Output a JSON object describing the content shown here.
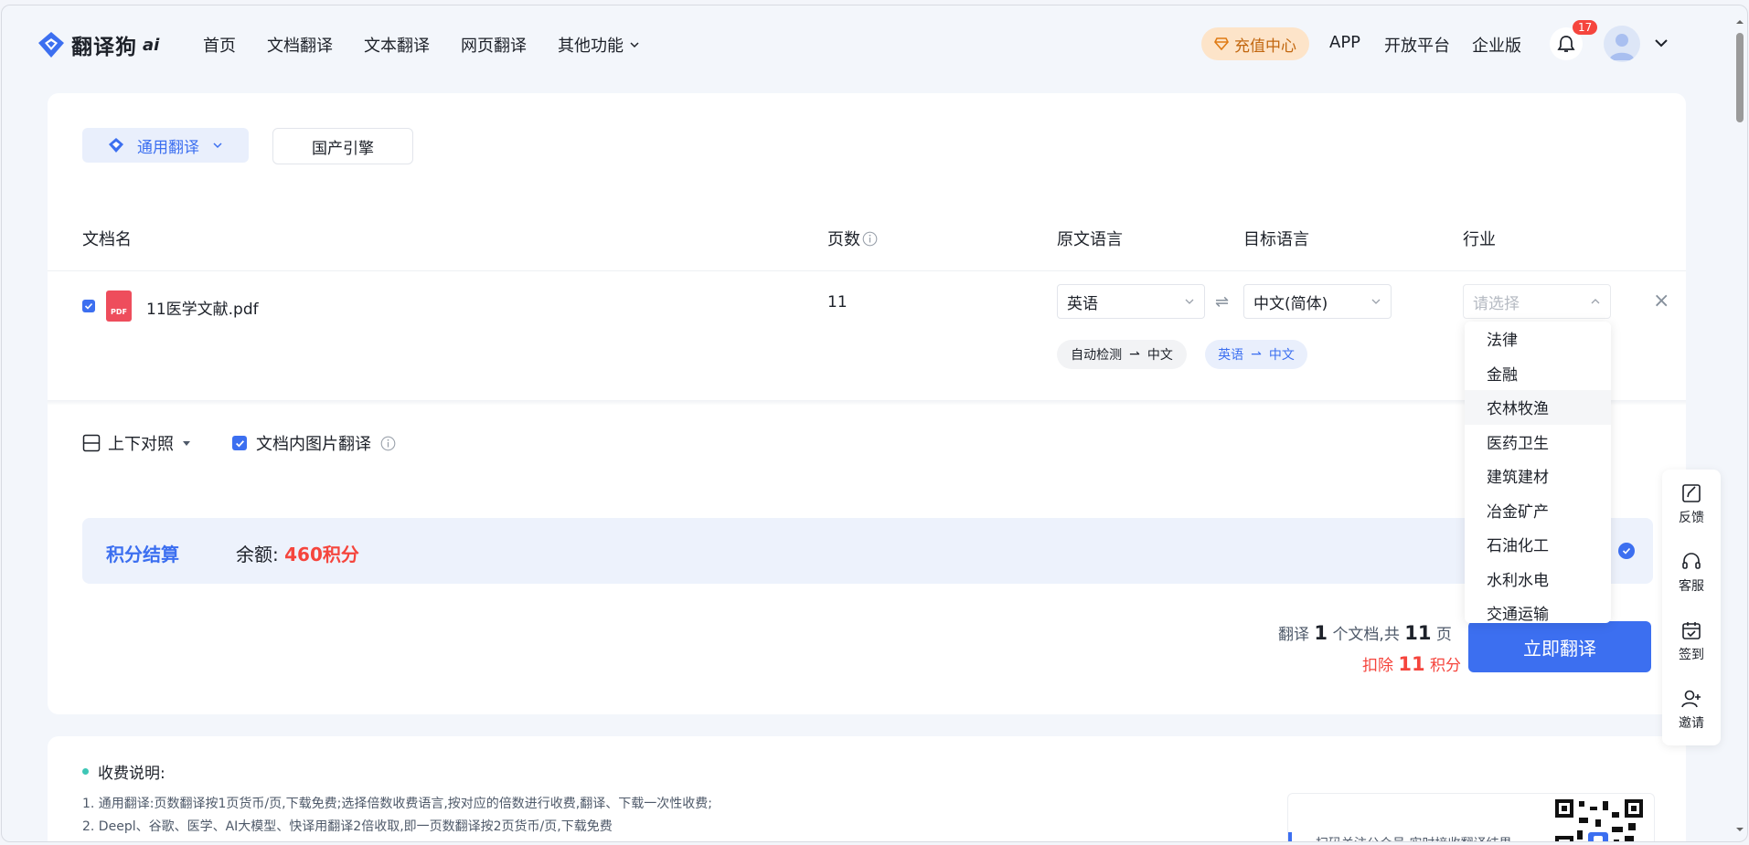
{
  "header": {
    "logo_text": "翻译狗",
    "logo_suffix": "ai",
    "nav": [
      "首页",
      "文档翻译",
      "文本翻译",
      "网页翻译",
      "其他功能"
    ],
    "recharge_label": "充值中心",
    "links": [
      "APP",
      "开放平台",
      "企业版"
    ],
    "notification_count": "17"
  },
  "engine": {
    "selected": "通用翻译",
    "alt": "国产引擎"
  },
  "table": {
    "headers": {
      "filename": "文档名",
      "pages": "页数",
      "source_lang": "原文语言",
      "target_lang": "目标语言",
      "industry": "行业"
    },
    "row": {
      "filename": "11医学文献.pdf",
      "file_type": "PDF",
      "pages": "11",
      "source_lang": "英语",
      "target_lang": "中文(简体)",
      "industry_placeholder": "请选择",
      "chips": [
        {
          "from": "自动检测",
          "to": "中文"
        },
        {
          "from": "英语",
          "to": "中文"
        }
      ]
    }
  },
  "industry_options": [
    "法律",
    "金融",
    "农林牧渔",
    "医药卫生",
    "建筑建材",
    "冶金矿产",
    "石油化工",
    "水利水电",
    "交通运输"
  ],
  "options": {
    "layout": "上下对照",
    "image_translate": "文档内图片翻译"
  },
  "settlement": {
    "title": "积分结算",
    "balance_label": "余额:",
    "balance_value": "460积分"
  },
  "summary": {
    "translate_prefix": "翻译",
    "doc_count": "1",
    "doc_suffix": "个文档,共",
    "page_count": "11",
    "page_suffix": "页",
    "deduct_prefix": "扣除",
    "deduct_value": "11",
    "deduct_suffix": "积分"
  },
  "translate_button": "立即翻译",
  "fee": {
    "title": "收费说明:",
    "lines": [
      "1. 通用翻译:页数翻译按1页货币/页,下载免费;选择倍数收费语言,按对应的倍数进行收费,翻译、下载一次性收费;",
      "2. Deepl、谷歌、医学、AI大模型、快译用翻译2倍收取,即一页数翻译按2页货币/页,下载免费"
    ]
  },
  "qr": {
    "text": "扫码关注公众号,实时接收翻译结果"
  },
  "side_toolbar": [
    "反馈",
    "客服",
    "签到",
    "邀请"
  ],
  "colors": {
    "primary": "#3c6ff0",
    "danger": "#f5453d",
    "recharge_bg": "#fde4c9",
    "recharge_text": "#c2670f"
  }
}
